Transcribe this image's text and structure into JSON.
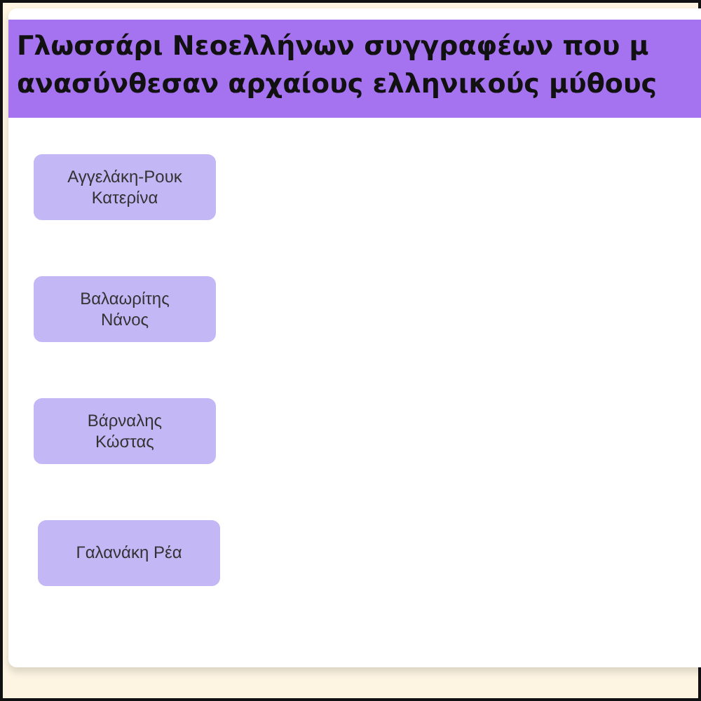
{
  "header": {
    "title_lines": [
      "Γλωσσάρι Νεοελλήνων συγγραφέων που μ",
      "ανασύνθεσαν αρχαίους ελληνικούς μύθους"
    ]
  },
  "authors": [
    {
      "lines": [
        "Αγγελάκη-Ρουκ",
        "Κατερίνα"
      ]
    },
    {
      "lines": [
        "Βαλαωρίτης",
        "Νάνος"
      ]
    },
    {
      "lines": [
        "Βάρναλης",
        "Κώστας"
      ]
    },
    {
      "lines": [
        "Γαλανάκη Ρέα"
      ]
    }
  ]
}
